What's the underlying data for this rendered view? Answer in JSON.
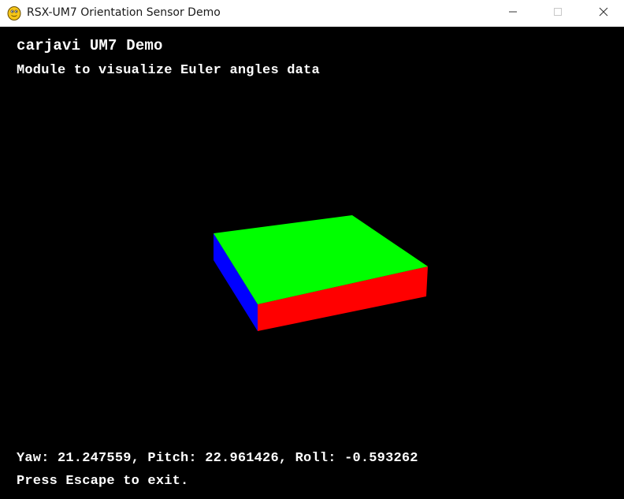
{
  "window": {
    "title": "RSX-UM7 Orientation Sensor Demo",
    "app_icon": "python-snake-icon",
    "controls": {
      "minimize": "minimize-icon",
      "maximize": "maximize-icon",
      "close": "close-icon"
    }
  },
  "hud": {
    "title": "carjavi UM7 Demo",
    "subtitle": "Module to visualize Euler angles data",
    "angles_text": "Yaw: 21.247559, Pitch: 22.961426, Roll: -0.593262",
    "exit_hint": "Press Escape to exit."
  },
  "orientation": {
    "yaw": 21.247559,
    "pitch": 22.961426,
    "roll": -0.593262
  },
  "cube": {
    "top_face_color": "#00ff00",
    "front_face_color": "#ff0000",
    "left_face_color": "#0000ff"
  }
}
